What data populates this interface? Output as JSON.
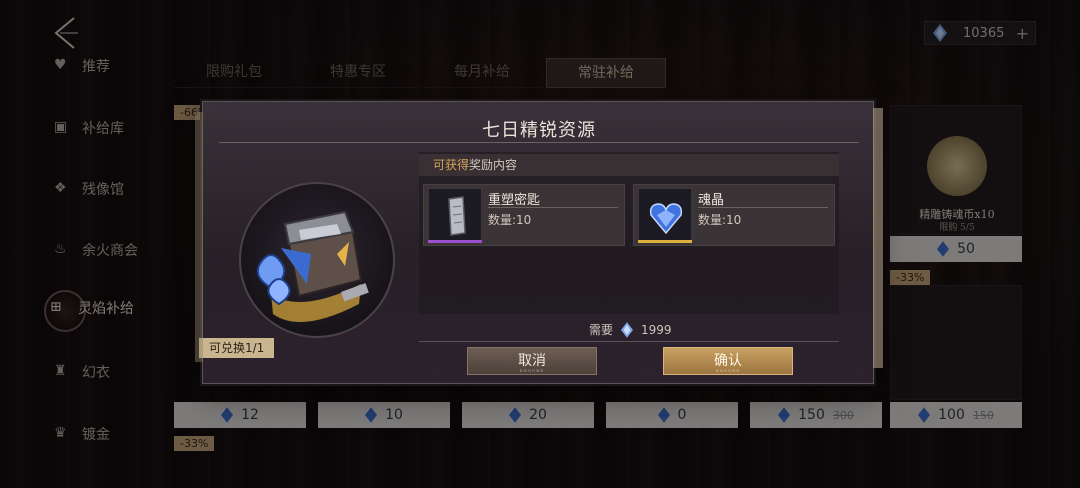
{
  "header": {
    "currency_amount": "10365",
    "currency_plus": "+"
  },
  "sidebar": {
    "items": [
      {
        "label": "推荐"
      },
      {
        "label": "补给库"
      },
      {
        "label": "残像馆"
      },
      {
        "label": "余火商会"
      },
      {
        "label": "灵焰补给"
      },
      {
        "label": "幻衣"
      },
      {
        "label": "镀金"
      }
    ]
  },
  "tabs": [
    {
      "label": "限购礼包"
    },
    {
      "label": "特惠专区"
    },
    {
      "label": "每月补给"
    },
    {
      "label": "常驻补给"
    }
  ],
  "shop_cards": {
    "prices": [
      "12",
      "10",
      "20",
      "0",
      "150",
      "100"
    ],
    "old_prices": [
      "",
      "",
      "",
      "",
      "300",
      "150"
    ],
    "right_top": {
      "name": "精雕铸魂币x10",
      "limit": "限购 5/5",
      "price": "50"
    },
    "discounts": [
      "-66%",
      "-33%",
      "-33%"
    ]
  },
  "modal": {
    "title": "七日精锐资源",
    "redeem_tag": "可兑换1/1",
    "reward_head_highlight": "可获得",
    "reward_head_rest": "奖励内容",
    "items": [
      {
        "name": "重塑密匙",
        "qty": "数量:10",
        "rarity_color": "#9b4fd1"
      },
      {
        "name": "魂晶",
        "qty": "数量:10",
        "rarity_color": "#e0b13a"
      }
    ],
    "cost_label": "需要",
    "cost_value": "1999",
    "cancel_label": "取消",
    "confirm_label": "确认",
    "button_sub": "ENSURE"
  },
  "colors": {
    "accent_gold": "#d6a35a",
    "gem_blue": "#7fa6e6"
  }
}
